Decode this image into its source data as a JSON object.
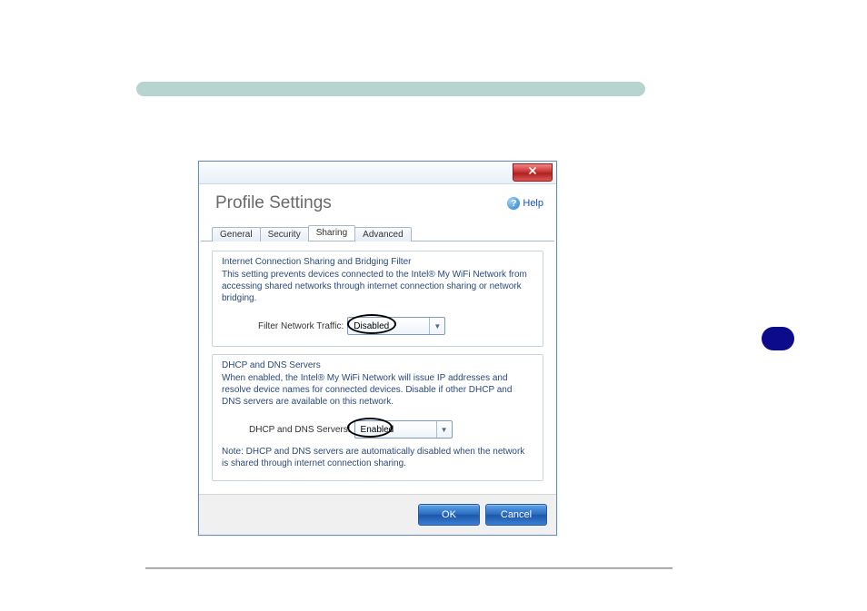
{
  "dialog": {
    "title": "Profile Settings",
    "help_label": "Help",
    "tabs": [
      {
        "label": "General"
      },
      {
        "label": "Security"
      },
      {
        "label": "Sharing"
      },
      {
        "label": "Advanced"
      }
    ]
  },
  "group1": {
    "title": "Internet Connection Sharing and Bridging Filter",
    "desc": "This setting prevents devices connected to the Intel® My WiFi Network from accessing shared networks through internet connection sharing or network bridging.",
    "field_label": "Filter Network Traffic:",
    "value": "Disabled"
  },
  "group2": {
    "title": "DHCP and DNS Servers",
    "desc": "When enabled, the Intel® My WiFi Network will issue IP addresses and resolve device names for connected devices.  Disable if other DHCP and DNS servers are available on this network.",
    "field_label": "DHCP and DNS Servers:",
    "value": "Enabled",
    "note": "Note: DHCP and DNS servers are automatically disabled when the network is shared through internet connection sharing."
  },
  "buttons": {
    "ok": "OK",
    "cancel": "Cancel"
  }
}
